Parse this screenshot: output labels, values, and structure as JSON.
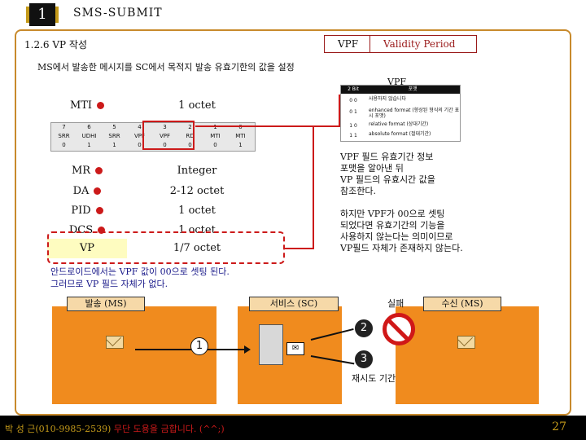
{
  "header": {
    "number": "1",
    "title": "SMS-SUBMIT"
  },
  "section": {
    "title": "1.2.6 VP 작성",
    "vpf_tag": "VPF",
    "vp_tag": "Validity Period"
  },
  "description": "MS에서 발송한 메시지를 SC에서 목적지 발송 유효기한의 값을 설정",
  "vpf_label": "VPF",
  "fields": [
    {
      "name": "MTI",
      "value": "1 octet",
      "dot": true,
      "highlight": false
    },
    {
      "name": "MR",
      "value": "Integer",
      "dot": true,
      "highlight": false
    },
    {
      "name": "DA",
      "value": "2-12 octet",
      "dot": true,
      "highlight": false
    },
    {
      "name": "PID",
      "value": "1 octet",
      "dot": true,
      "highlight": false
    },
    {
      "name": "DCS",
      "value": "1 octet",
      "dot": true,
      "highlight": false
    },
    {
      "name": "VP",
      "value": "1/7 octet",
      "dot": false,
      "highlight": true
    }
  ],
  "bit_header": [
    "7",
    "6",
    "5",
    "4",
    "3",
    "2",
    "1",
    "0"
  ],
  "bit_names": [
    "SRR",
    "UDHI",
    "SRR",
    "VPF",
    "VPF",
    "RD",
    "MTI",
    "MTI"
  ],
  "bit_values": [
    "0",
    "1",
    "1",
    "0",
    "0",
    "0",
    "0",
    "1"
  ],
  "vpf_table": {
    "headers": [
      "2 Bit",
      "포맷"
    ],
    "rows": [
      {
        "bits": "0 0",
        "format": "사용하지 않습니다"
      },
      {
        "bits": "0 1",
        "format": "enhanced format (향상된 형식의 기간 표시 포맷)"
      },
      {
        "bits": "1 0",
        "format": "relative format (상대기간)"
      },
      {
        "bits": "1 1",
        "format": "absolute format (절대기간)"
      }
    ]
  },
  "notes": {
    "vpf_info": [
      "VPF 필드 유효기간 정보",
      "포맷을 알아낸 뒤",
      "VP 필드의 유효시간 값을",
      "참조한다."
    ],
    "vpf_00": [
      "하지만 VPF가 00으로 셋팅",
      "되었다면 유효기간의 기능을",
      "사용하지 않는다는 의미이므로",
      "VP필드 자체가 존재하지 않는다."
    ],
    "android": [
      "안드로이드에서는 VPF 값이 00으로 셋팅 된다.",
      "그러므로 VP 필드 자체가 없다."
    ]
  },
  "diagram": {
    "sender": "발송 (MS)",
    "service": "서비스 (SC)",
    "receiver": "수신 (MS)",
    "fail": "실패",
    "retry_period": "재시도 기간",
    "step1": "1",
    "step2": "2",
    "step3": "3"
  },
  "colors": {
    "orange": "#f08b1e",
    "red": "#cc1a1a",
    "gold": "#c49a1a",
    "highlight": "#fefcc0"
  },
  "footer": {
    "author": "박 성 근(010-9985-2539) ",
    "warning": "무단 도용을 금합니다. (^^;)",
    "page": "27"
  }
}
